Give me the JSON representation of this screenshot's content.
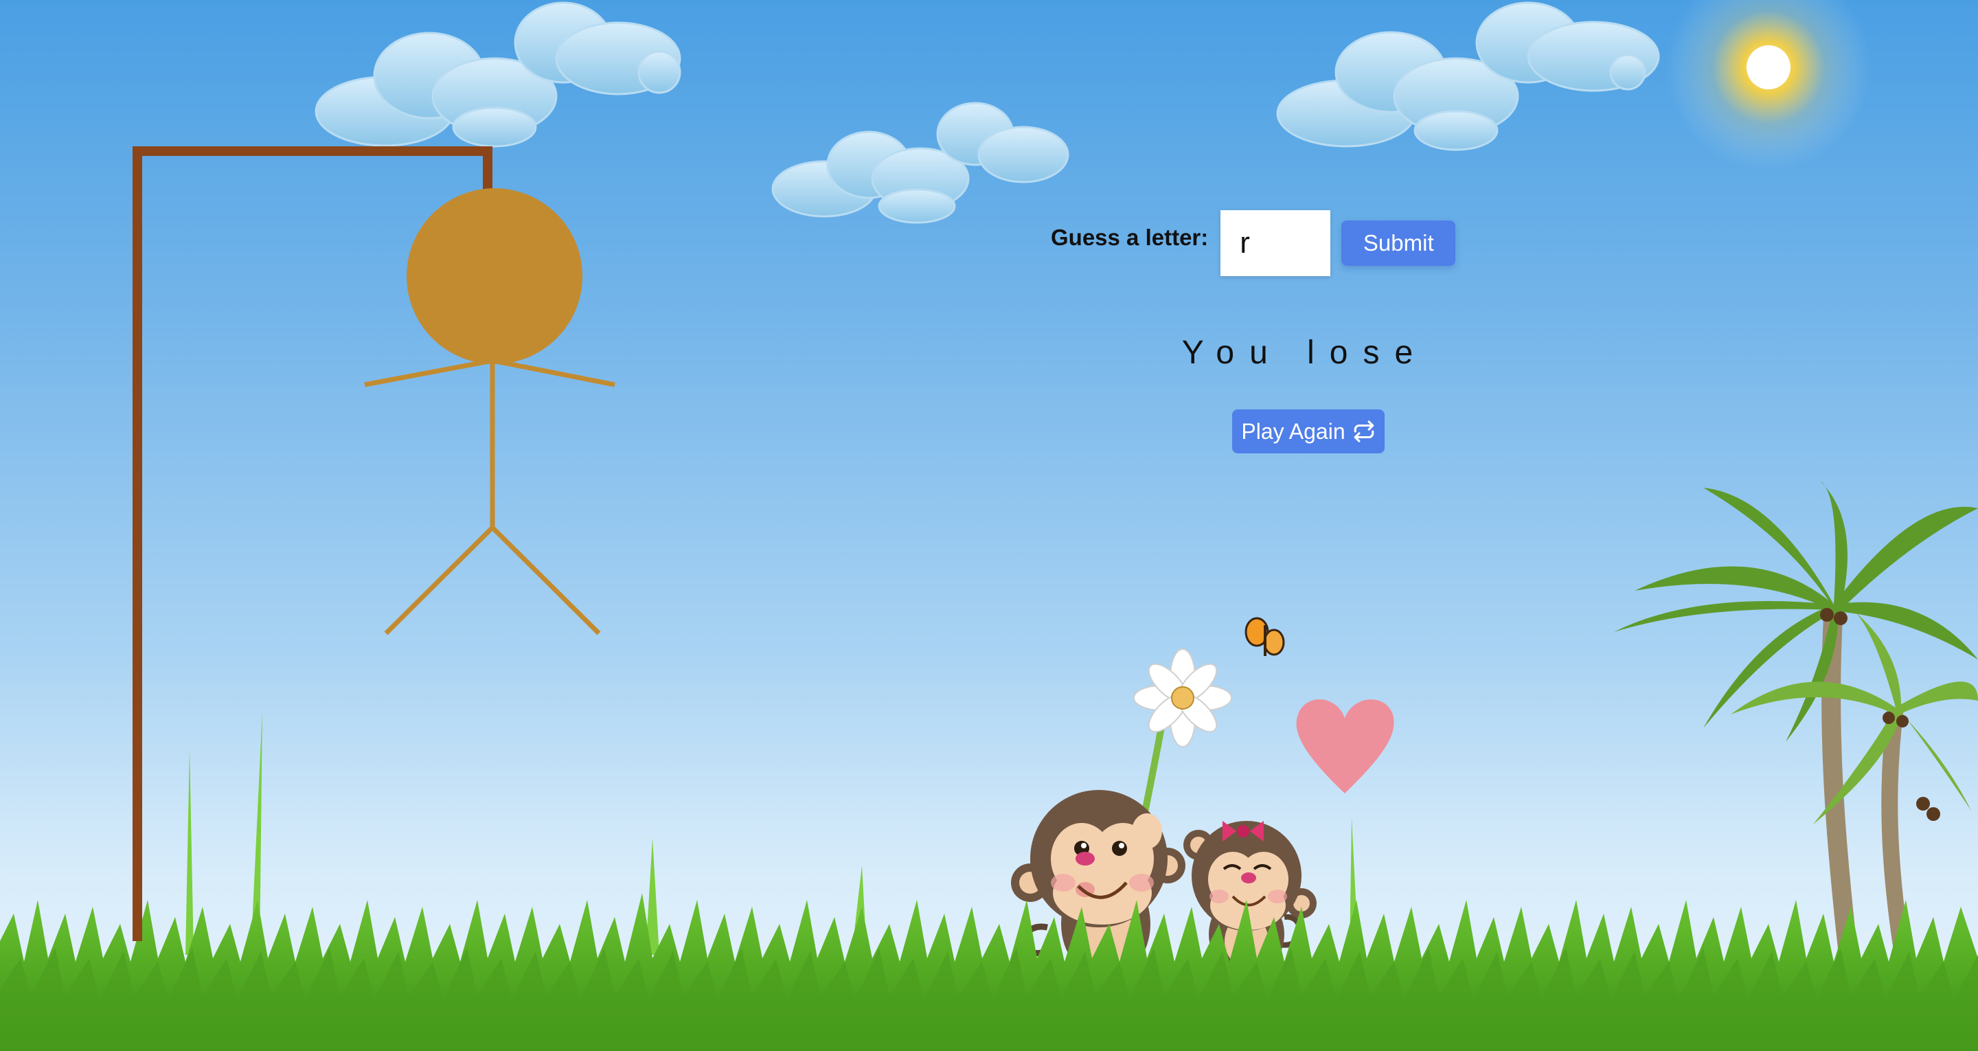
{
  "game": {
    "guess_label": "Guess a letter:",
    "guess_value": "r",
    "submit_label": "Submit",
    "result_text": "You lose",
    "play_again_label": "Play Again",
    "play_again_icon": "repeat-icon"
  },
  "colors": {
    "button": "#4f7fe8",
    "gallows": "#8b4519",
    "figure": "#c38b30",
    "sky_top": "#4a9fe3",
    "grass": "#4fae21"
  }
}
